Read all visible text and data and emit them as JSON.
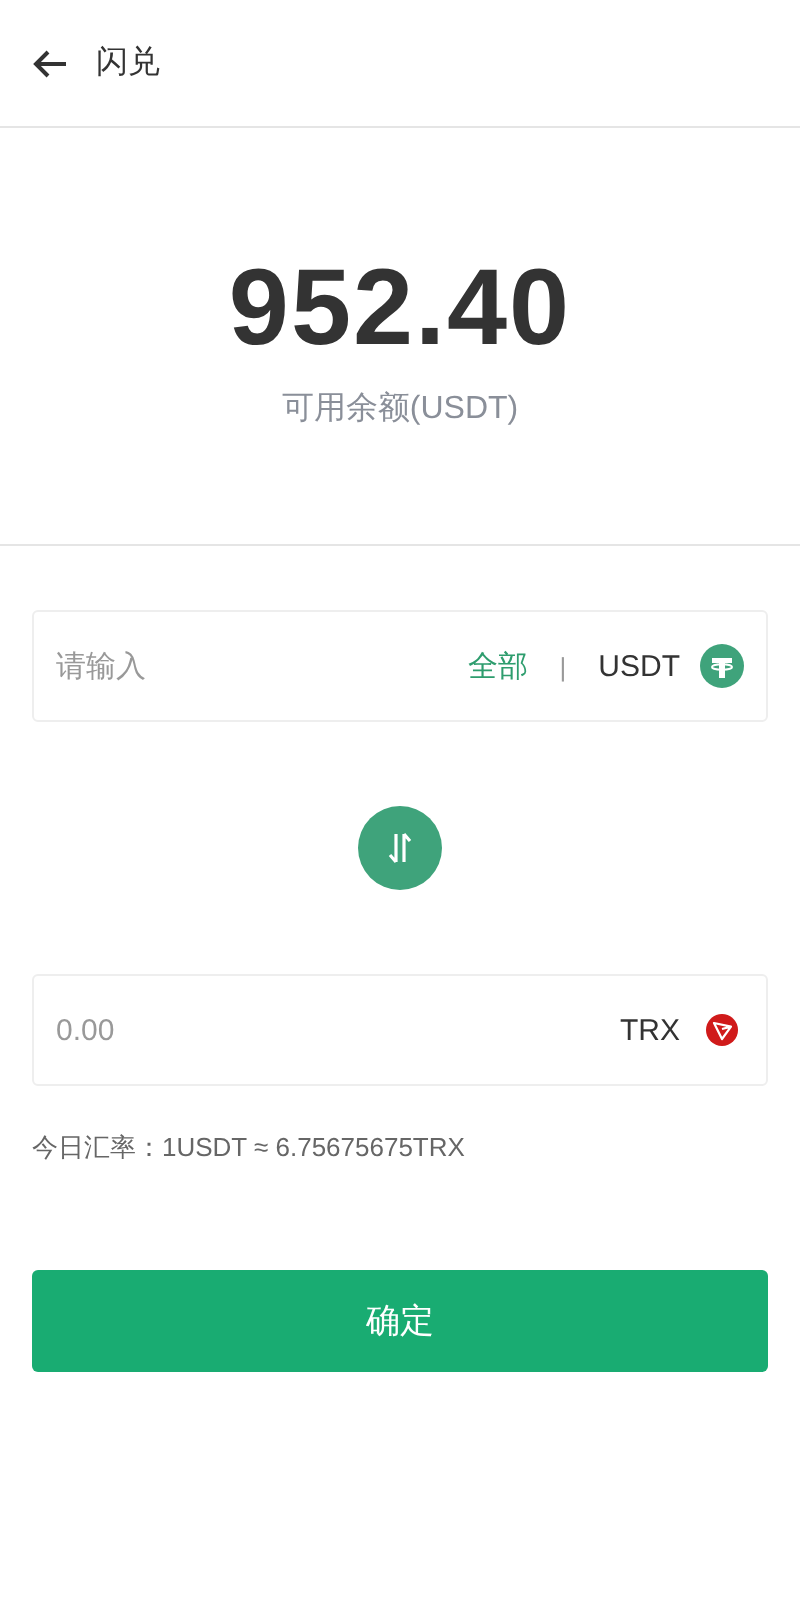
{
  "header": {
    "title": "闪兑"
  },
  "balance": {
    "amount": "952.40",
    "label": "可用余额(USDT)"
  },
  "fields": [
    {
      "placeholder": "请输入",
      "all_link": "全部",
      "separator": "|",
      "currency": "USDT"
    },
    {
      "placeholder": "0.00",
      "currency": "TRX"
    }
  ],
  "rate": "今日汇率：1USDT ≈ 6.75675675TRX",
  "confirm_button": "确定"
}
